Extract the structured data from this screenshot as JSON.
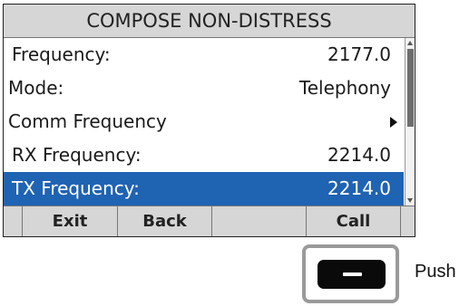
{
  "screen": {
    "title": "COMPOSE NON-DISTRESS",
    "rows": [
      {
        "label": "Frequency:",
        "value": "2177.0"
      },
      {
        "label": "Mode:",
        "value": "Telephony"
      },
      {
        "label": "Comm Frequency",
        "value": ""
      },
      {
        "label": "RX Frequency:",
        "value": "2214.0"
      },
      {
        "label": "TX Frequency:",
        "value": "2214.0"
      }
    ],
    "softkeys": [
      "Exit",
      "Back",
      "",
      "Call"
    ]
  },
  "hardware": {
    "push_label": "Push"
  },
  "colors": {
    "selection": "#1f63b3",
    "bar_background": "#d6d6d6"
  }
}
